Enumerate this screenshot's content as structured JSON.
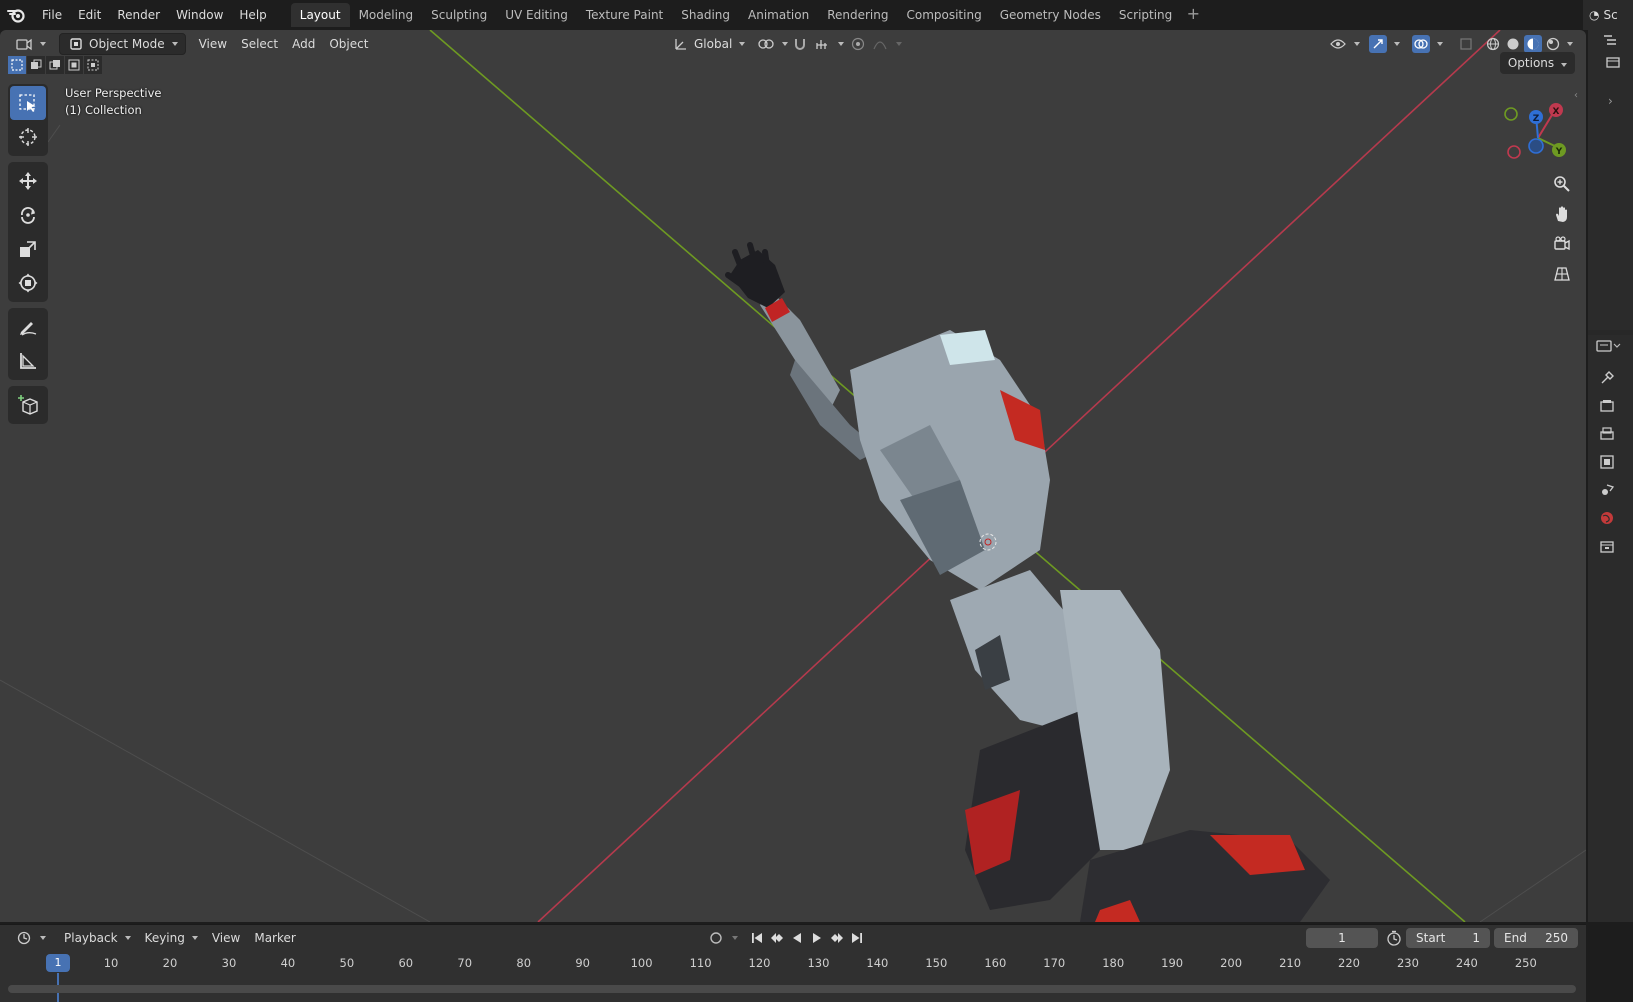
{
  "menu": {
    "items": [
      "File",
      "Edit",
      "Render",
      "Window",
      "Help"
    ]
  },
  "workspaces": {
    "tabs": [
      "Layout",
      "Modeling",
      "Sculpting",
      "UV Editing",
      "Texture Paint",
      "Shading",
      "Animation",
      "Rendering",
      "Compositing",
      "Geometry Nodes",
      "Scripting"
    ],
    "active": "Layout",
    "add_label": "+"
  },
  "scene_selector": {
    "label": "Sc"
  },
  "viewport": {
    "mode_label": "Object Mode",
    "menus": [
      "View",
      "Select",
      "Add",
      "Object"
    ],
    "transform_orientation": "Global",
    "overlay_title": "User Perspective",
    "overlay_collection": "(1) Collection",
    "options_label": "Options",
    "gizmo": {
      "x_label": "X",
      "y_label": "Y",
      "z_label": "Z"
    },
    "colors": {
      "background": "#3d3d3d",
      "x_axis": "#c0394f",
      "y_axis": "#6e9a22",
      "z_axis": "#2f6fd6",
      "accent": "#4772b3"
    }
  },
  "toolbar": {
    "tools": [
      "select-box",
      "cursor",
      "move",
      "rotate",
      "scale",
      "transform",
      "annotate",
      "measure",
      "add-cube"
    ],
    "active": "select-box"
  },
  "properties_tabs": [
    "tool",
    "render",
    "output",
    "view-layer",
    "scene",
    "world",
    "collection"
  ],
  "timeline": {
    "menus": [
      "Playback",
      "Keying",
      "View",
      "Marker"
    ],
    "current_frame": "1",
    "start_label": "Start",
    "start_value": "1",
    "end_label": "End",
    "end_value": "250",
    "ruler_ticks": [
      "10",
      "20",
      "30",
      "40",
      "50",
      "60",
      "70",
      "80",
      "90",
      "100",
      "110",
      "120",
      "130",
      "140",
      "150",
      "160",
      "170",
      "180",
      "190",
      "200",
      "210",
      "220",
      "230",
      "240",
      "250"
    ],
    "playhead_label": "1"
  }
}
